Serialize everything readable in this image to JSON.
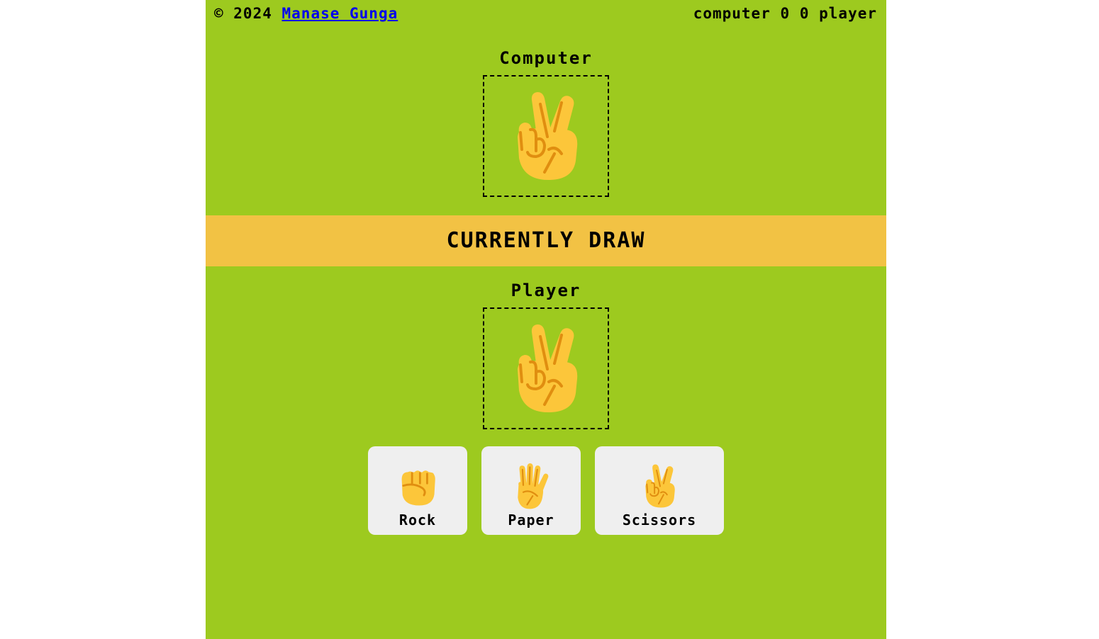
{
  "header": {
    "copyright_prefix": "© 2024",
    "author_link": "Manase Gunga",
    "score_computer_label": "computer",
    "score_computer": "0",
    "score_player": "0",
    "score_player_label": "player"
  },
  "computer": {
    "title": "Computer",
    "current_choice_icon": "victory-hand-icon"
  },
  "status": {
    "text": "CURRENTLY DRAW"
  },
  "player": {
    "title": "Player",
    "current_choice_icon": "victory-hand-icon"
  },
  "choices": [
    {
      "label": "Rock",
      "icon": "raised-fist-icon"
    },
    {
      "label": "Paper",
      "icon": "raised-hand-icon"
    },
    {
      "label": "Scissors",
      "icon": "victory-hand-icon"
    }
  ],
  "colors": {
    "background": "#9dca1f",
    "banner": "#f2c244",
    "button": "#efefef",
    "hand": "#fcc63a",
    "hand_shadow": "#e08e10",
    "link": "#0000ee"
  }
}
